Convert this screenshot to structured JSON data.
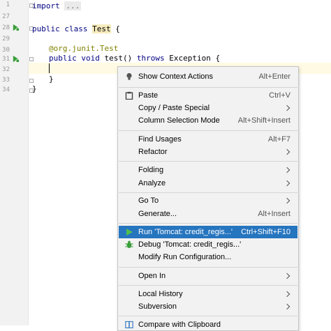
{
  "editor": {
    "line_numbers": [
      "1",
      "27",
      "28",
      "29",
      "30",
      "31",
      "32",
      "33",
      "34"
    ],
    "lines": {
      "import_kw": "import",
      "import_folded": "...",
      "class_kw": "public class",
      "class_name": "Test",
      "class_brace": "{",
      "annotation": "@org.junit.Test",
      "method_kw": "public void",
      "method_name": "test()",
      "throws_kw": "throws",
      "exception": "Exception {",
      "close_method": "}",
      "close_class": "}"
    }
  },
  "menu": {
    "items": [
      {
        "label": "Show Context Actions",
        "shortcut": "Alt+Enter",
        "icon": "lightbulb-icon"
      },
      {
        "label": "Paste",
        "shortcut": "Ctrl+V",
        "icon": "clipboard-icon"
      },
      {
        "label": "Copy / Paste Special",
        "shortcut": ""
      },
      {
        "label": "Column Selection Mode",
        "shortcut": "Alt+Shift+Insert"
      },
      {
        "label": "Find Usages",
        "shortcut": "Alt+F7"
      },
      {
        "label": "Refactor",
        "shortcut": ""
      },
      {
        "label": "Folding",
        "shortcut": ""
      },
      {
        "label": "Analyze",
        "shortcut": ""
      },
      {
        "label": "Go To",
        "shortcut": ""
      },
      {
        "label": "Generate...",
        "shortcut": "Alt+Insert"
      },
      {
        "label": "Run 'Tomcat: credit_regis...'",
        "shortcut": "Ctrl+Shift+F10",
        "icon": "run-icon"
      },
      {
        "label": "Debug 'Tomcat: credit_regis...'",
        "shortcut": "",
        "icon": "debug-bug-icon"
      },
      {
        "label": "Modify Run Configuration...",
        "shortcut": ""
      },
      {
        "label": "Open In",
        "shortcut": ""
      },
      {
        "label": "Local History",
        "shortcut": ""
      },
      {
        "label": "Subversion",
        "shortcut": ""
      },
      {
        "label": "Compare with Clipboard",
        "shortcut": "",
        "icon": "compare-icon"
      }
    ]
  },
  "colors": {
    "selection": "#2675bf",
    "menu_bg": "#f2f2f2",
    "run_green": "#3a9e3a",
    "caret_line": "#fffae3"
  }
}
